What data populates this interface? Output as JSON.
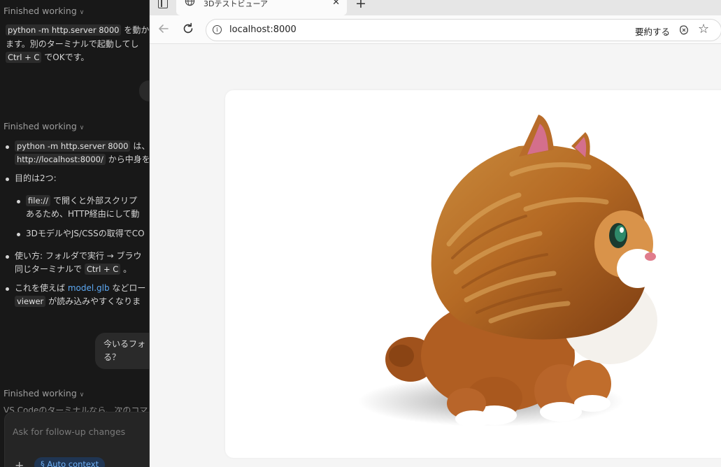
{
  "chat": {
    "status_label": "Finished working",
    "msg1": {
      "code1": "python -m http.server 8000",
      "text1": "を動か",
      "line2": "ます。別のターミナルで起動してし",
      "code2": "Ctrl + C",
      "text3": "でOKです。"
    },
    "bullets": [
      {
        "code": "python -m http.server 8000",
        "after": "は、",
        "code2": "http://localhost:8000/",
        "after2": "から中身を"
      },
      {
        "text": "目的は2つ:"
      },
      {
        "code": "file://",
        "after": "で開くと外部スクリプ",
        "line2": "あるため、HTTP経由にして動"
      },
      {
        "text": "3DモデルやJS/CSSの取得でCO"
      },
      {
        "text": "使い方: フォルダで実行 → ブラウ",
        "line2_pre": "同じターミナルで",
        "code": "Ctrl + C",
        "line2_post": "。"
      },
      {
        "pre": "これを使えば",
        "link": "model.glb",
        "post": "などロー",
        "line2_link": "viewer",
        "line2_post": "が読み込みやすくなりま"
      }
    ],
    "user_message": {
      "line1": "今いるフォ",
      "line2": "る？"
    },
    "truncated_line": "VS Codeのターミナルなら、次のコマ",
    "composer": {
      "placeholder": "Ask for follow-up changes",
      "plus": "+",
      "auto_context": "Auto context"
    }
  },
  "browser": {
    "tab_title": "3Dテストビューア",
    "address": "localhost:8000",
    "summarize": "要約する",
    "icons": [
      "sidebar-toggle-icon",
      "globe-icon",
      "close-icon",
      "new-tab-icon",
      "back-icon",
      "reload-icon",
      "info-icon",
      "copilot-icon",
      "favorite-star-icon"
    ]
  },
  "viewer": {
    "model": "orange-cat-model"
  }
}
